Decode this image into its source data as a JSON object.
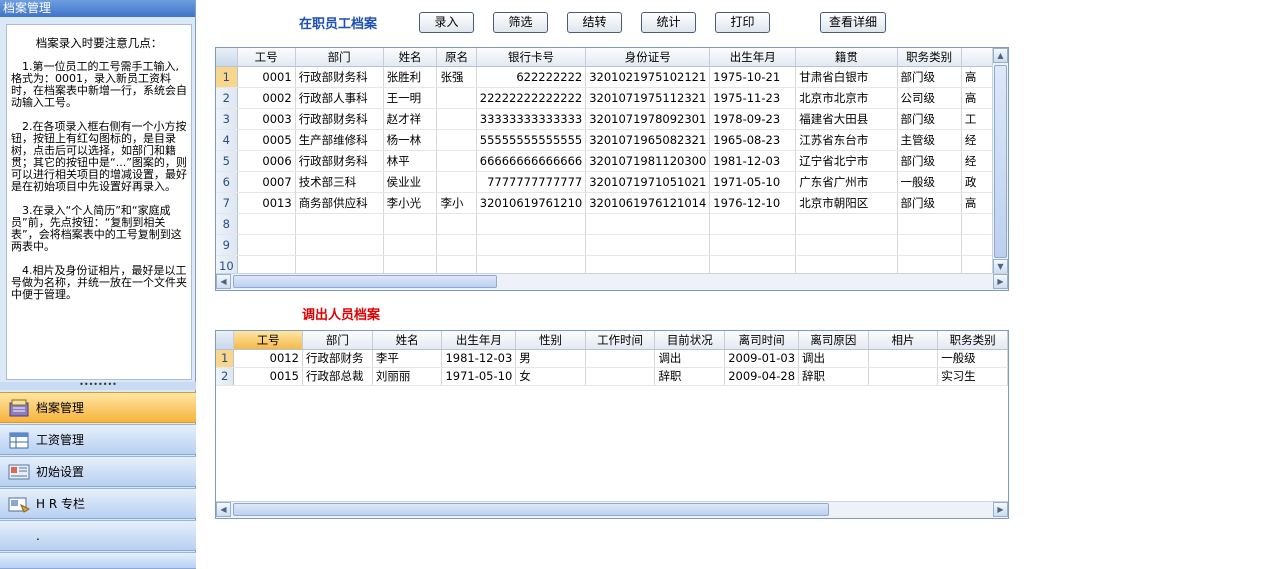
{
  "sidebar": {
    "title": "档案管理",
    "notice": {
      "heading": "档案录入时要注意几点：",
      "paragraphs": [
        "1.第一位员工的工号需手工输入,格式为：0001，录入新员工资料时，在档案表中新增一行，系统会自动输入工号。",
        "2.在各项录入框右侧有一个小方按钮，按钮上有红勾图标的，是目录树，点击后可以选择，如部门和籍贯；其它的按钮中是“...”图案的，则可以进行相关项目的增减设置，最好是在初始项目中先设置好再录入。",
        "3.在录入“个人简历”和“家庭成员”前，先点按钮：“复制到相关表”，会将档案表中的工号复制到这两表中。",
        "4.相片及身份证相片，最好是以工号做为名称，并统一放在一个文件夹中便于管理。"
      ]
    },
    "splitter_mark": "••••••••",
    "nav": [
      {
        "label": "档案管理",
        "icon": "archive-icon"
      },
      {
        "label": "工资管理",
        "icon": "salary-table-icon"
      },
      {
        "label": "初始设置",
        "icon": "settings-icon"
      },
      {
        "label": "H R 专栏",
        "icon": "hr-column-icon"
      },
      {
        "label": ".",
        "icon": ""
      }
    ]
  },
  "toolbar": {
    "title": "在职员工档案",
    "buttons": [
      "录入",
      "筛选",
      "结转",
      "统计",
      "打印",
      "查看详细"
    ]
  },
  "grid1": {
    "columns": [
      "工号",
      "部门",
      "姓名",
      "原名",
      "银行卡号",
      "身份证号",
      "出生年月",
      "籍贯",
      "职务类别",
      ""
    ],
    "rows": [
      [
        "0001",
        "行政部财务科",
        "张胜利",
        "张强",
        "622222222",
        "3201021975102121",
        "1975-10-21",
        "甘肃省白银市",
        "部门级",
        "高"
      ],
      [
        "0002",
        "行政部人事科",
        "王一明",
        "",
        "22222222222222",
        "3201071975112321",
        "1975-11-23",
        "北京市北京市",
        "公司级",
        "高"
      ],
      [
        "0003",
        "行政部财务科",
        "赵才祥",
        "",
        "33333333333333",
        "3201071978092301",
        "1978-09-23",
        "福建省大田县",
        "部门级",
        "工"
      ],
      [
        "0005",
        "生产部维修科",
        "杨一林",
        "",
        "55555555555555",
        "3201071965082321",
        "1965-08-23",
        "江苏省东台市",
        "主管级",
        "经"
      ],
      [
        "0006",
        "行政部财务科",
        "林平",
        "",
        "66666666666666",
        "3201071981120300",
        "1981-12-03",
        "辽宁省北宁市",
        "部门级",
        "经"
      ],
      [
        "0007",
        "技术部三科",
        "侯业业",
        "",
        "7777777777777",
        "3201071971051021",
        "1971-05-10",
        "广东省广州市",
        "一般级",
        "政"
      ],
      [
        "0013",
        "商务部供应科",
        "李小光",
        "李小",
        "32010619761210",
        "3201061976121014",
        "1976-12-10",
        "北京市朝阳区",
        "部门级",
        "高"
      ],
      [
        "",
        "",
        "",
        "",
        "",
        "",
        "",
        "",
        "",
        ""
      ],
      [
        "",
        "",
        "",
        "",
        "",
        "",
        "",
        "",
        "",
        ""
      ],
      [
        "",
        "",
        "",
        "",
        "",
        "",
        "",
        "",
        "",
        ""
      ]
    ],
    "row_numbers": [
      "1",
      "2",
      "3",
      "4",
      "5",
      "6",
      "7",
      "8",
      "9",
      "10"
    ]
  },
  "section2": {
    "title": "调出人员档案"
  },
  "grid2": {
    "columns": [
      "工号",
      "部门",
      "姓名",
      "出生年月",
      "性别",
      "工作时间",
      "目前状况",
      "离司时间",
      "离司原因",
      "相片",
      "职务类别"
    ],
    "rows": [
      [
        "0012",
        "行政部财务",
        "李平",
        "1981-12-03",
        "男",
        "",
        "调出",
        "2009-01-03",
        "调出",
        "",
        "一般级"
      ],
      [
        "0015",
        "行政部总裁",
        "刘丽丽",
        "1971-05-10",
        "女",
        "",
        "辞职",
        "2009-04-28",
        "辞职",
        "",
        "实习生"
      ]
    ],
    "row_numbers": [
      "1",
      "2"
    ]
  }
}
